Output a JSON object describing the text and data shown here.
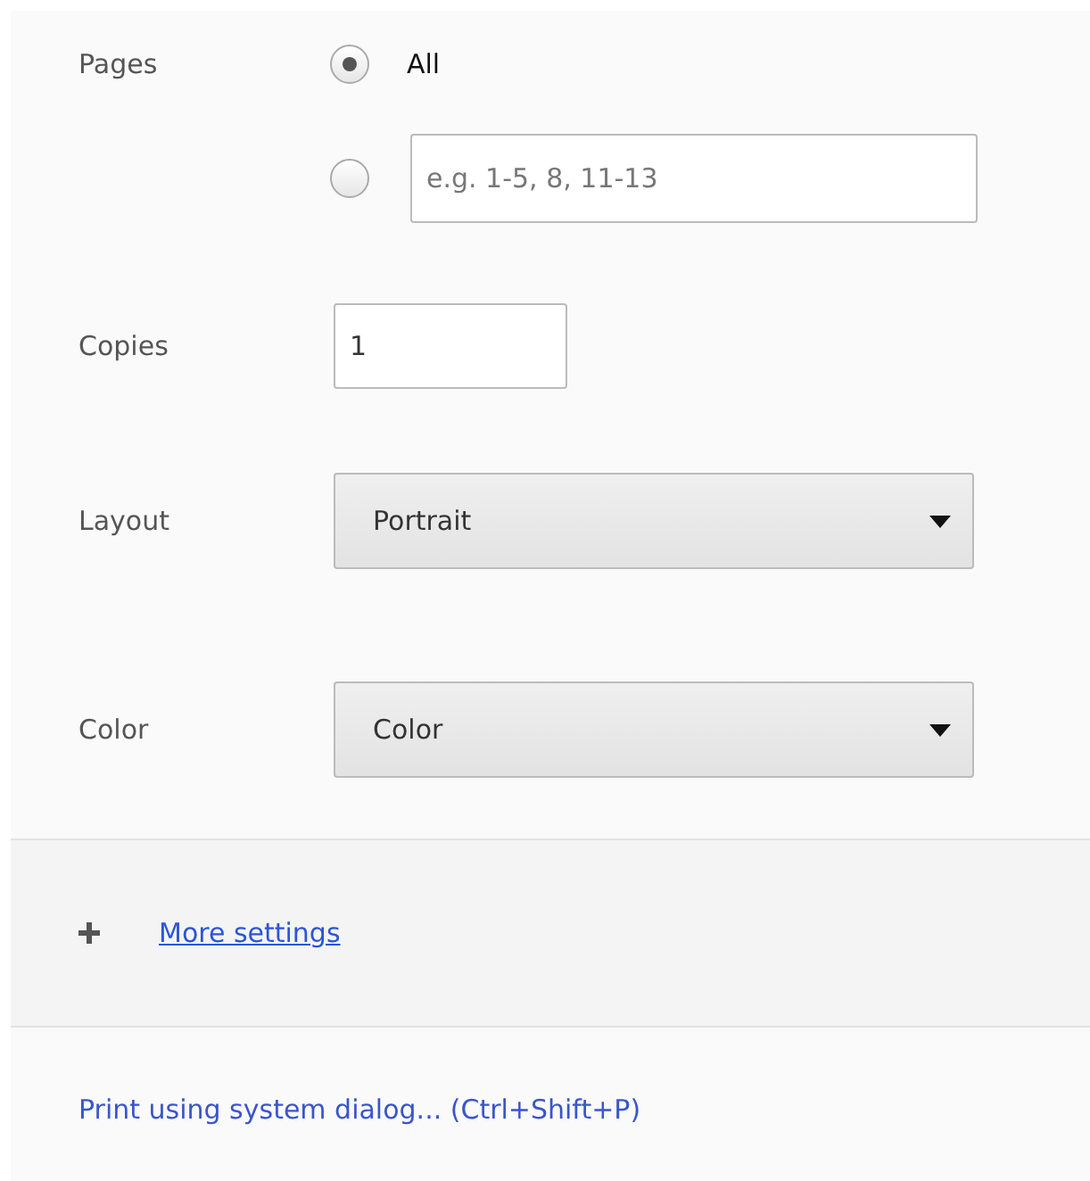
{
  "settings": [
    {
      "kind": "radios",
      "label": "Pages",
      "options": [
        {
          "kind": "plain",
          "label": "All",
          "selected": true
        },
        {
          "kind": "range",
          "placeholder": "e.g. 1-5, 8, 11-13",
          "selected": false
        }
      ]
    },
    {
      "kind": "number",
      "label": "Copies",
      "value": "1"
    },
    {
      "kind": "select",
      "label": "Layout",
      "value": "Portrait"
    },
    {
      "kind": "select",
      "label": "Color",
      "value": "Color"
    }
  ],
  "more_settings": {
    "label": "More settings"
  },
  "system_dialog_link": "Print using system dialog... (Ctrl+Shift+P)"
}
